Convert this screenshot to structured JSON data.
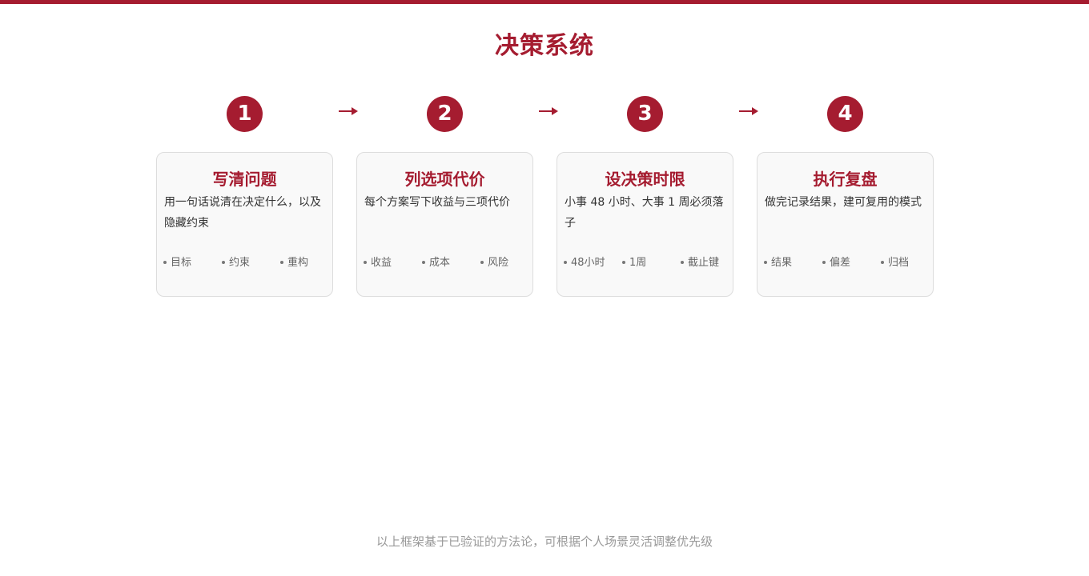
{
  "header": {
    "title": "决策系统"
  },
  "colors": {
    "accent": "#a51c30",
    "card_bg": "#f9f9f9",
    "card_border": "#dddddd",
    "muted_text": "#999999"
  },
  "steps": [
    {
      "number": "1",
      "title": "写清问题",
      "description": "用一句话说清在决定什么，以及隐藏约束",
      "tags": [
        "目标",
        "约束",
        "重构"
      ]
    },
    {
      "number": "2",
      "title": "列选项代价",
      "description": "每个方案写下收益与三项代价",
      "tags": [
        "收益",
        "成本",
        "风险"
      ]
    },
    {
      "number": "3",
      "title": "设决策时限",
      "description": "小事 48 小时、大事 1 周必须落子",
      "tags": [
        "48小时",
        "1周",
        "截止键"
      ]
    },
    {
      "number": "4",
      "title": "执行复盘",
      "description": "做完记录结果，建可复用的模式",
      "tags": [
        "结果",
        "偏差",
        "归档"
      ]
    }
  ],
  "arrow_icon": "arrow-right-icon",
  "footer": {
    "note": "以上框架基于已验证的方法论，可根据个人场景灵活调整优先级"
  }
}
